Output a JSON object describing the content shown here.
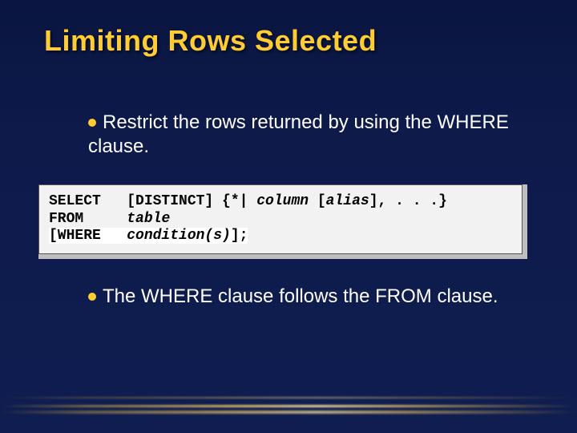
{
  "title": "Limiting Rows Selected",
  "bullets": {
    "b1": "Restrict the rows returned by using the WHERE clause.",
    "b2": "The WHERE clause follows the FROM clause."
  },
  "code": {
    "kw_select": "SELECT",
    "kw_from": "FROM",
    "kw_where": "[WHERE",
    "distinct": "[DISTINCT] {*| ",
    "column": "column",
    "alias_open": " [",
    "alias": "alias",
    "alias_close": "], . . .}",
    "table": "table",
    "condition": "condition(s)",
    "close": "];"
  }
}
